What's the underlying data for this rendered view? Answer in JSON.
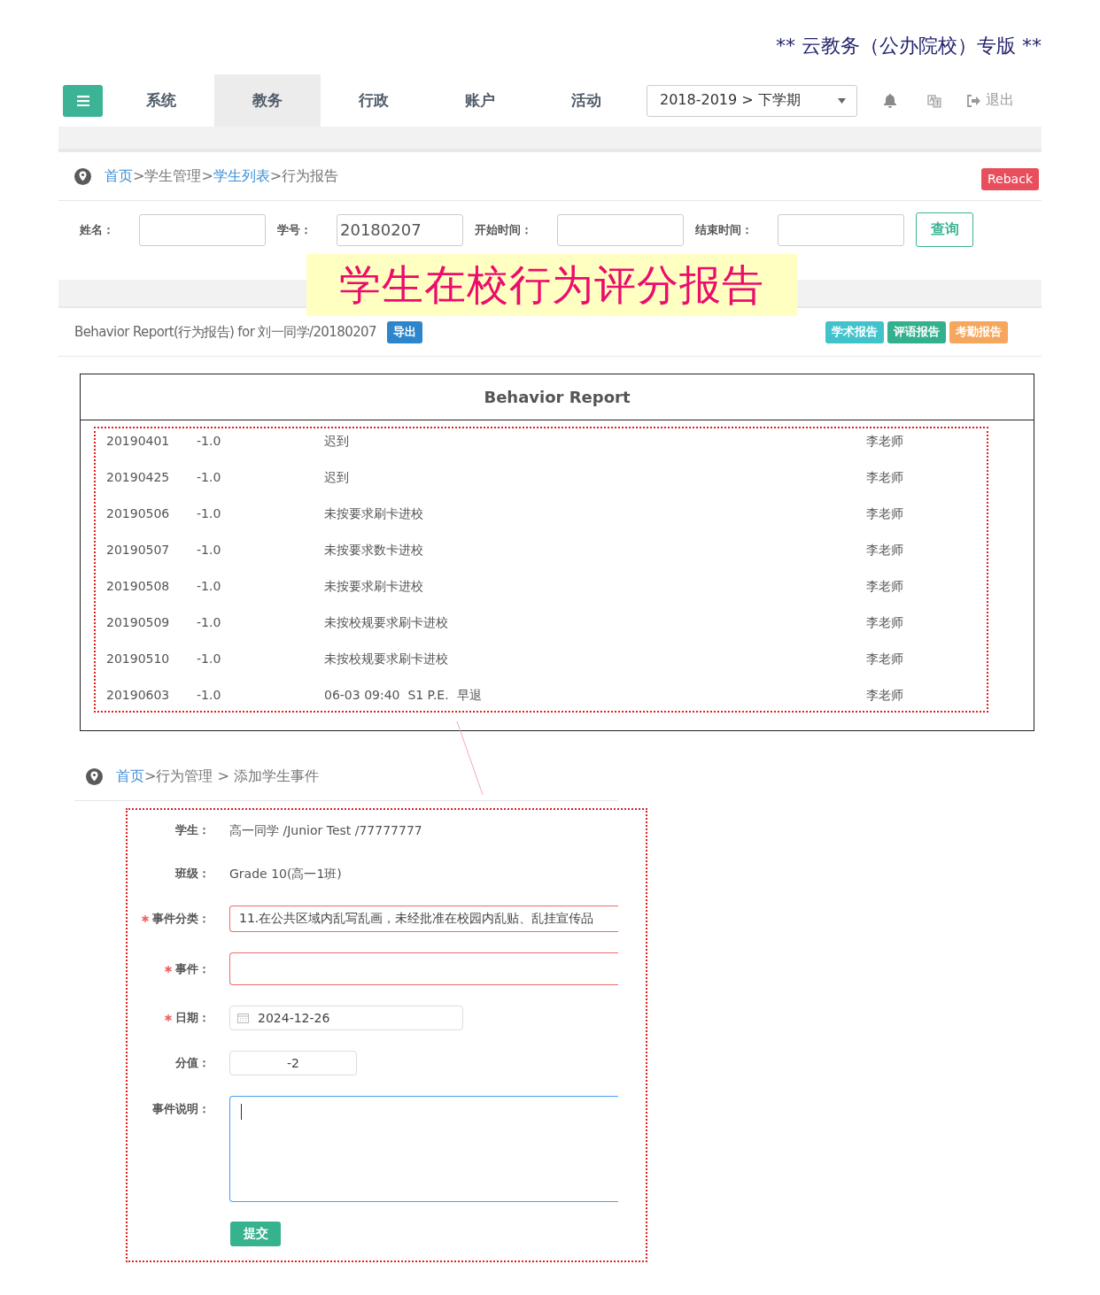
{
  "banner": "** 云教务（公办院校）专版 **",
  "nav": {
    "tabs": [
      {
        "label": "系统",
        "selected": false
      },
      {
        "label": "教务",
        "selected": true
      },
      {
        "label": "行政",
        "selected": false
      },
      {
        "label": "账户",
        "selected": false
      },
      {
        "label": "活动",
        "selected": false
      }
    ],
    "term_select": "2018-2019 > 下学期",
    "logout": "退出"
  },
  "breadcrumb": [
    {
      "text": "首页",
      "link": true
    },
    {
      "text": ">学生管理>",
      "link": false
    },
    {
      "text": "学生列表",
      "link": true
    },
    {
      "text": ">行为报告",
      "link": false
    }
  ],
  "reback_button": "Reback",
  "search": {
    "fields": [
      {
        "label": "姓名："
      },
      {
        "label": "学号：",
        "value": "20180207"
      },
      {
        "label": "开始时间："
      },
      {
        "label": "结束时间："
      }
    ],
    "query_button": "查询"
  },
  "overlay_title": "学生在校行为评分报告",
  "report_header": {
    "title": "Behavior Report(行为报告) for 刘一同学/20180207",
    "export_button": "导出",
    "report_buttons": [
      {
        "label": "学术报告",
        "color": "#41c3cc"
      },
      {
        "label": "评语报告",
        "color": "#33b08e"
      },
      {
        "label": "考勤报告",
        "color": "#f6a75d"
      }
    ]
  },
  "behavior_report": {
    "title": "Behavior Report",
    "rows": [
      {
        "date": "20190401",
        "score": "-1.0",
        "event": "迟到",
        "teacher": "李老师"
      },
      {
        "date": "20190425",
        "score": "-1.0",
        "event": "迟到",
        "teacher": "李老师"
      },
      {
        "date": "20190506",
        "score": "-1.0",
        "event": "未按要求刷卡进校",
        "teacher": "李老师"
      },
      {
        "date": "20190507",
        "score": "-1.0",
        "event": "未按要求数卡进校",
        "teacher": "李老师"
      },
      {
        "date": "20190508",
        "score": "-1.0",
        "event": "未按要求刷卡进校",
        "teacher": "李老师"
      },
      {
        "date": "20190509",
        "score": "-1.0",
        "event": "未按校规要求刷卡进校",
        "teacher": "李老师"
      },
      {
        "date": "20190510",
        "score": "-1.0",
        "event": "未按校规要求刷卡进校",
        "teacher": "李老师"
      },
      {
        "date": "20190603",
        "score": "-1.0",
        "event": "06-03 09:40  S1 P.E.  早退",
        "teacher": "李老师"
      }
    ]
  },
  "add_event": {
    "breadcrumb": [
      {
        "text": "首页",
        "link": true
      },
      {
        "text": ">行为管理 > 添加学生事件",
        "link": false
      }
    ],
    "fields": [
      {
        "kind": "text",
        "label": "学生：",
        "required": false,
        "value": "高一同学 /Junior Test /77777777"
      },
      {
        "kind": "text",
        "label": "班级：",
        "required": false,
        "value": "Grade 10(高一1班)"
      },
      {
        "kind": "input",
        "label": "事件分类：",
        "required": true,
        "invalid": true,
        "value": "11.在公共区域内乱写乱画，未经批准在校园内乱贴、乱挂宣传品"
      },
      {
        "kind": "input",
        "label": "事件：",
        "required": true,
        "invalid": true
      },
      {
        "kind": "date",
        "label": "日期：",
        "required": true,
        "value": "2024-12-26"
      },
      {
        "kind": "number",
        "label": "分值：",
        "required": false,
        "value": "-2"
      },
      {
        "kind": "textarea",
        "label": "事件说明：",
        "required": false,
        "focused": true
      }
    ],
    "submit_button": "提交"
  }
}
